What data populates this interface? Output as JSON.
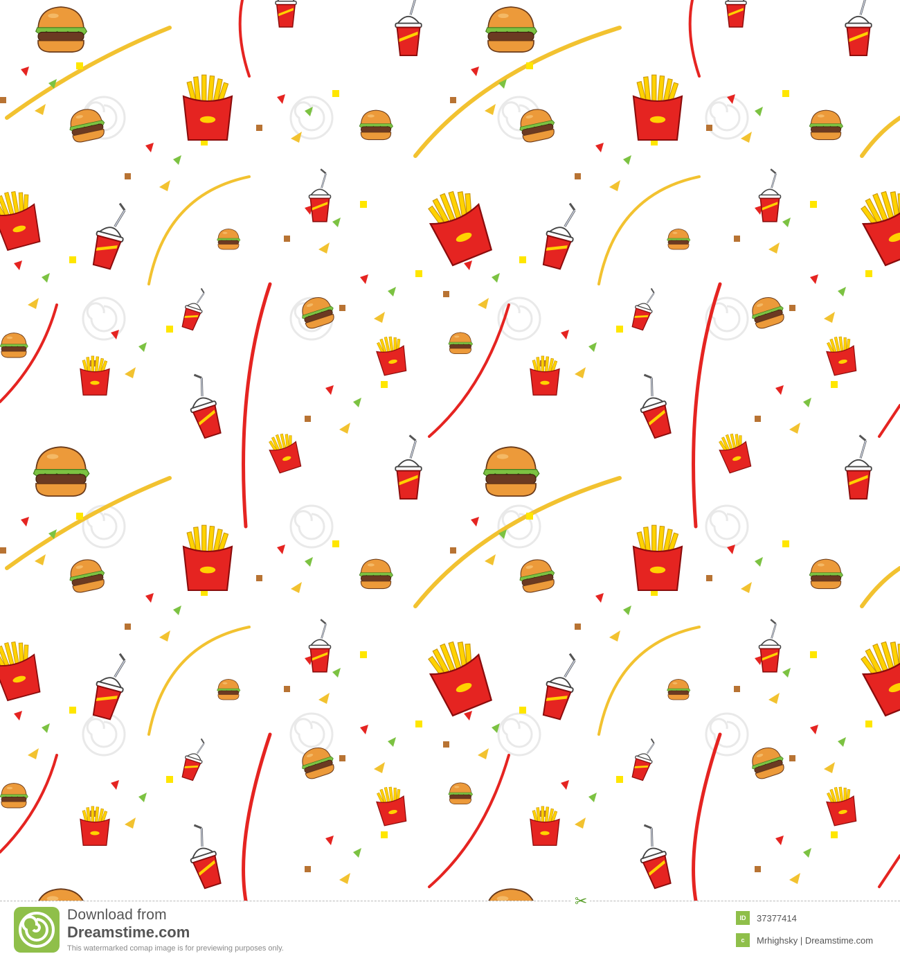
{
  "footer": {
    "download_text": "Download from",
    "brand": "Dreamstime.com",
    "note": "This watermarked comap image is for previewing purposes only.",
    "id_label": "ID",
    "id_value": "37377414",
    "credit_icon": "c",
    "credit": "Mrhighsky | Dreamstime.com"
  },
  "colors": {
    "brand_green": "#8fbf4a",
    "bun": "#e8983a",
    "patty": "#6b3a22",
    "lettuce": "#7cc242",
    "red": "#e52421",
    "fries": "#ffd200",
    "ribbon_yellow": "#f2c230"
  },
  "icons": [
    "burger-icon",
    "fries-icon",
    "soda-cup-icon",
    "confetti",
    "ribbon",
    "spiral-logo-icon",
    "scissors-icon"
  ]
}
